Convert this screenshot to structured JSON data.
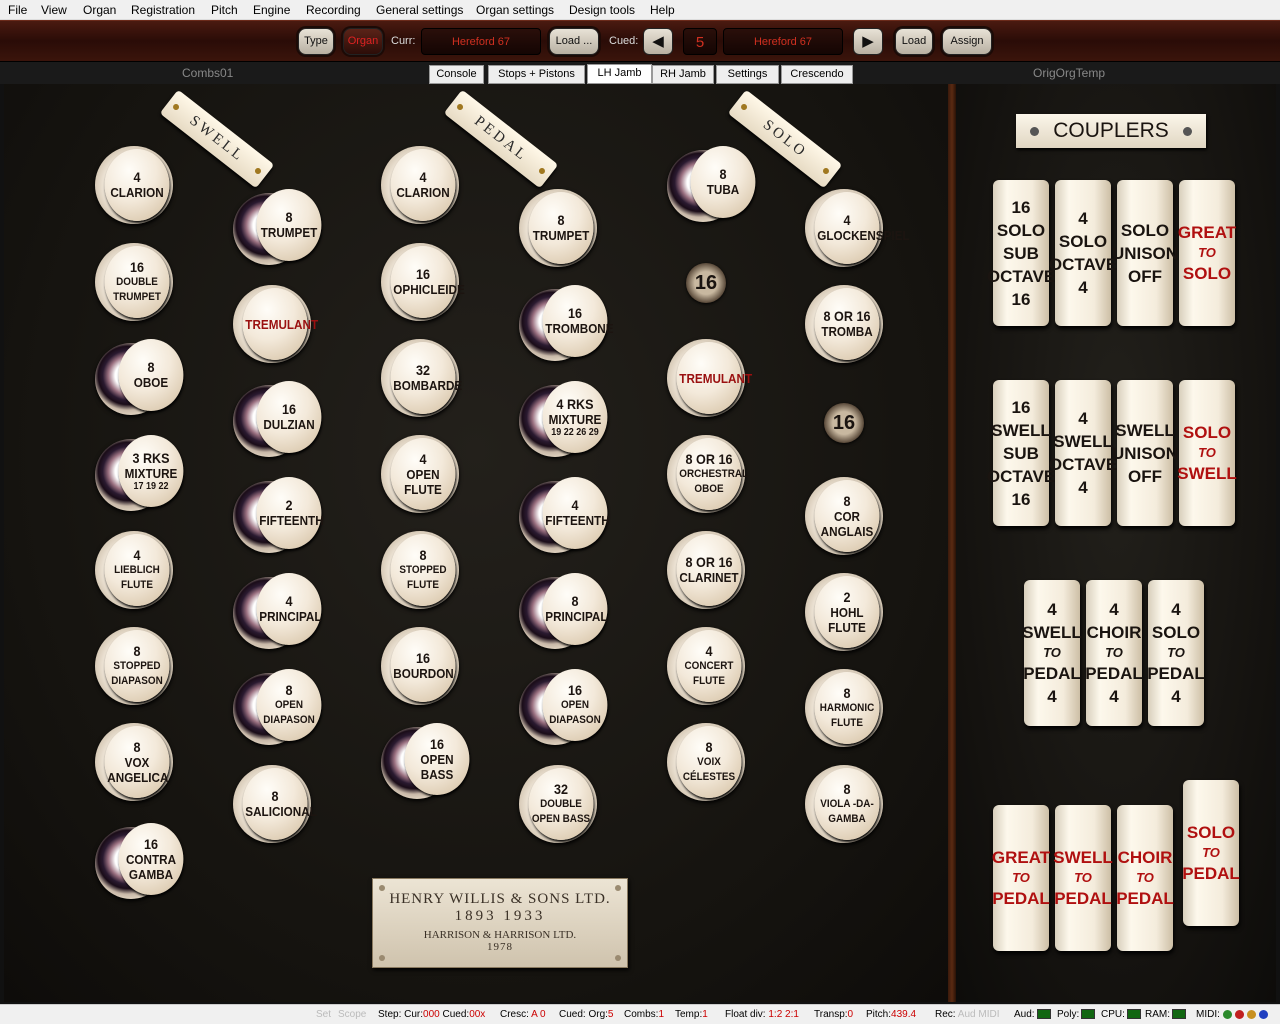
{
  "menu": [
    "File",
    "View",
    "Organ",
    "Registration",
    "Pitch",
    "Engine",
    "Recording",
    "General settings",
    "Organ settings",
    "Design tools",
    "Help"
  ],
  "toolbar": {
    "type_label": "Type",
    "organ_label": "Organ",
    "curr_label": "Curr:",
    "curr_value": "Hereford 67",
    "load_dots_label": "Load ...",
    "cued_label": "Cued:",
    "cued_number": "5",
    "cued_value": "Hereford 67",
    "load_label": "Load",
    "assign_label": "Assign",
    "prev_icon": "◀",
    "next_icon": "▶"
  },
  "tabs": {
    "left_label": "Combs01",
    "right_label": "OrigOrgTemp",
    "items": [
      "Console",
      "Stops + Pistons",
      "LH Jamb",
      "RH Jamb",
      "Settings",
      "Crescendo"
    ],
    "active": "LH Jamb"
  },
  "scrolls": {
    "swell": "SWELL",
    "pedal": "PEDAL",
    "solo": "SOLO"
  },
  "stops": {
    "c1": [
      {
        "n": "4",
        "t": "CLARION"
      },
      {
        "n": "16",
        "t": "DOUBLE TRUMPET"
      },
      {
        "n": "8",
        "t": "OBOE"
      },
      {
        "n": "3 RKS",
        "t": "MIXTURE",
        "s": "17  19  22"
      },
      {
        "n": "4",
        "t": "LIEBLICH FLUTE"
      },
      {
        "n": "8",
        "t": "STOPPED DIAPASON"
      },
      {
        "n": "8",
        "t": "VOX ANGELICA"
      },
      {
        "n": "16",
        "t": "CONTRA GAMBA"
      }
    ],
    "c2": [
      {
        "n": "8",
        "t": "TRUMPET"
      },
      {
        "n": "",
        "t": "TREMULANT",
        "red": true
      },
      {
        "n": "16",
        "t": "DULZIAN"
      },
      {
        "n": "2",
        "t": "FIFTEENTH"
      },
      {
        "n": "4",
        "t": "PRINCIPAL"
      },
      {
        "n": "8",
        "t": "OPEN DIAPASON"
      },
      {
        "n": "8",
        "t": "SALICIONAL"
      }
    ],
    "c3": [
      {
        "n": "4",
        "t": "CLARION"
      },
      {
        "n": "16",
        "t": "OPHICLEIDE"
      },
      {
        "n": "32",
        "t": "BOMBARDE"
      },
      {
        "n": "4",
        "t": "OPEN FLUTE"
      },
      {
        "n": "8",
        "t": "STOPPED FLUTE"
      },
      {
        "n": "16",
        "t": "BOURDON"
      },
      {
        "n": "16",
        "t": "OPEN BASS"
      }
    ],
    "c4": [
      {
        "n": "8",
        "t": "TRUMPET"
      },
      {
        "n": "16",
        "t": "TROMBONE"
      },
      {
        "n": "4 RKS",
        "t": "MIXTURE",
        "s": "19 22 26 29"
      },
      {
        "n": "4",
        "t": "FIFTEENTH"
      },
      {
        "n": "8",
        "t": "PRINCIPAL"
      },
      {
        "n": "16",
        "t": "OPEN DIAPASON"
      },
      {
        "n": "32",
        "t": "DOUBLE OPEN BASS"
      }
    ],
    "c5": [
      {
        "n": "8",
        "t": "TUBA"
      },
      {
        "n": "",
        "t": "TREMULANT",
        "red": true
      },
      {
        "n": "8 OR 16",
        "t": "ORCHESTRAL OBOE"
      },
      {
        "n": "8 OR 16",
        "t": "CLARINET"
      },
      {
        "n": "4",
        "t": "CONCERT FLUTE"
      },
      {
        "n": "8",
        "t": "VOIX CÉLESTES"
      }
    ],
    "c6": [
      {
        "n": "4",
        "t": "GLOCKENSPIEL"
      },
      {
        "n": "8 OR 16",
        "t": "TROMBA"
      },
      {
        "n": "8",
        "t": "COR ANGLAIS"
      },
      {
        "n": "2",
        "t": "HOHL FLUTE"
      },
      {
        "n": "8",
        "t": "HARMONIC FLUTE"
      },
      {
        "n": "8",
        "t": "VIOLA -DA- GAMBA"
      }
    ]
  },
  "badges": [
    "16",
    "16"
  ],
  "plaque": {
    "line1": "HENRY WILLIS & SONS LTD.",
    "line2": "1893   1933",
    "line3": "HARRISON & HARRISON LTD.",
    "line4": "1978"
  },
  "couplers": {
    "title": "COUPLERS",
    "row1": [
      {
        "a": "16",
        "b": "SOLO",
        "c": "SUB",
        "d": "OCTAVE",
        "e": "16"
      },
      {
        "a": "4",
        "b": "SOLO",
        "c": "OCTAVE",
        "e": "4"
      },
      {
        "b": "SOLO",
        "c": "UNISON",
        "d": "OFF"
      },
      {
        "b": "GREAT",
        "to": "TO",
        "d": "SOLO",
        "red": true
      }
    ],
    "row2": [
      {
        "a": "16",
        "b": "SWELL",
        "c": "SUB",
        "d": "OCTAVE",
        "e": "16"
      },
      {
        "a": "4",
        "b": "SWELL",
        "c": "OCTAVE",
        "e": "4"
      },
      {
        "b": "SWELL",
        "c": "UNISON",
        "d": "OFF"
      },
      {
        "b": "SOLO",
        "to": "TO",
        "d": "SWELL",
        "red": true
      }
    ],
    "row3": [
      {
        "a": "4",
        "b": "SWELL",
        "to": "TO",
        "d": "PEDAL",
        "e": "4"
      },
      {
        "a": "4",
        "b": "CHOIR",
        "to": "TO",
        "d": "PEDAL",
        "e": "4"
      },
      {
        "a": "4",
        "b": "SOLO",
        "to": "TO",
        "d": "PEDAL",
        "e": "4"
      }
    ],
    "row4": [
      {
        "b": "GREAT",
        "to": "TO",
        "d": "PEDAL",
        "red": true
      },
      {
        "b": "SWELL",
        "to": "TO",
        "d": "PEDAL",
        "red": true
      },
      {
        "b": "CHOIR",
        "to": "TO",
        "d": "PEDAL",
        "red": true
      },
      {
        "b": "SOLO",
        "to": "TO",
        "d": "PEDAL",
        "red": true
      }
    ]
  },
  "status": {
    "set": "Set",
    "scope": "Scope",
    "step_label": "Step: Cur:",
    "step_cur": "000",
    "cued_lbl": "Cued:",
    "step_cued": "00x",
    "cresc_label": "Cresc:",
    "cresc_val": "A 0",
    "cued_org_label": "Cued: Org:",
    "cued_org": "5",
    "combs_label": "Combs:",
    "combs": "1",
    "temp_label": "Temp:",
    "temp": "1",
    "float_label": "Float div:",
    "float": "1:2 2:1",
    "transp_label": "Transp:",
    "transp": "0",
    "pitch_label": "Pitch:",
    "pitch": "439.4",
    "rec_label": "Rec:",
    "aud_dim": "Aud",
    "midi_dim": "MIDI",
    "aud_label": "Aud:",
    "poly_label": "Poly:",
    "cpu_label": "CPU:",
    "ram_label": "RAM:",
    "midi_label": "MIDI:"
  },
  "colors": {
    "accent_red": "#d22",
    "led_green": "#2c8a2c",
    "led_red": "#c02020",
    "led_amber": "#c89020",
    "led_blue": "#2040c0"
  }
}
